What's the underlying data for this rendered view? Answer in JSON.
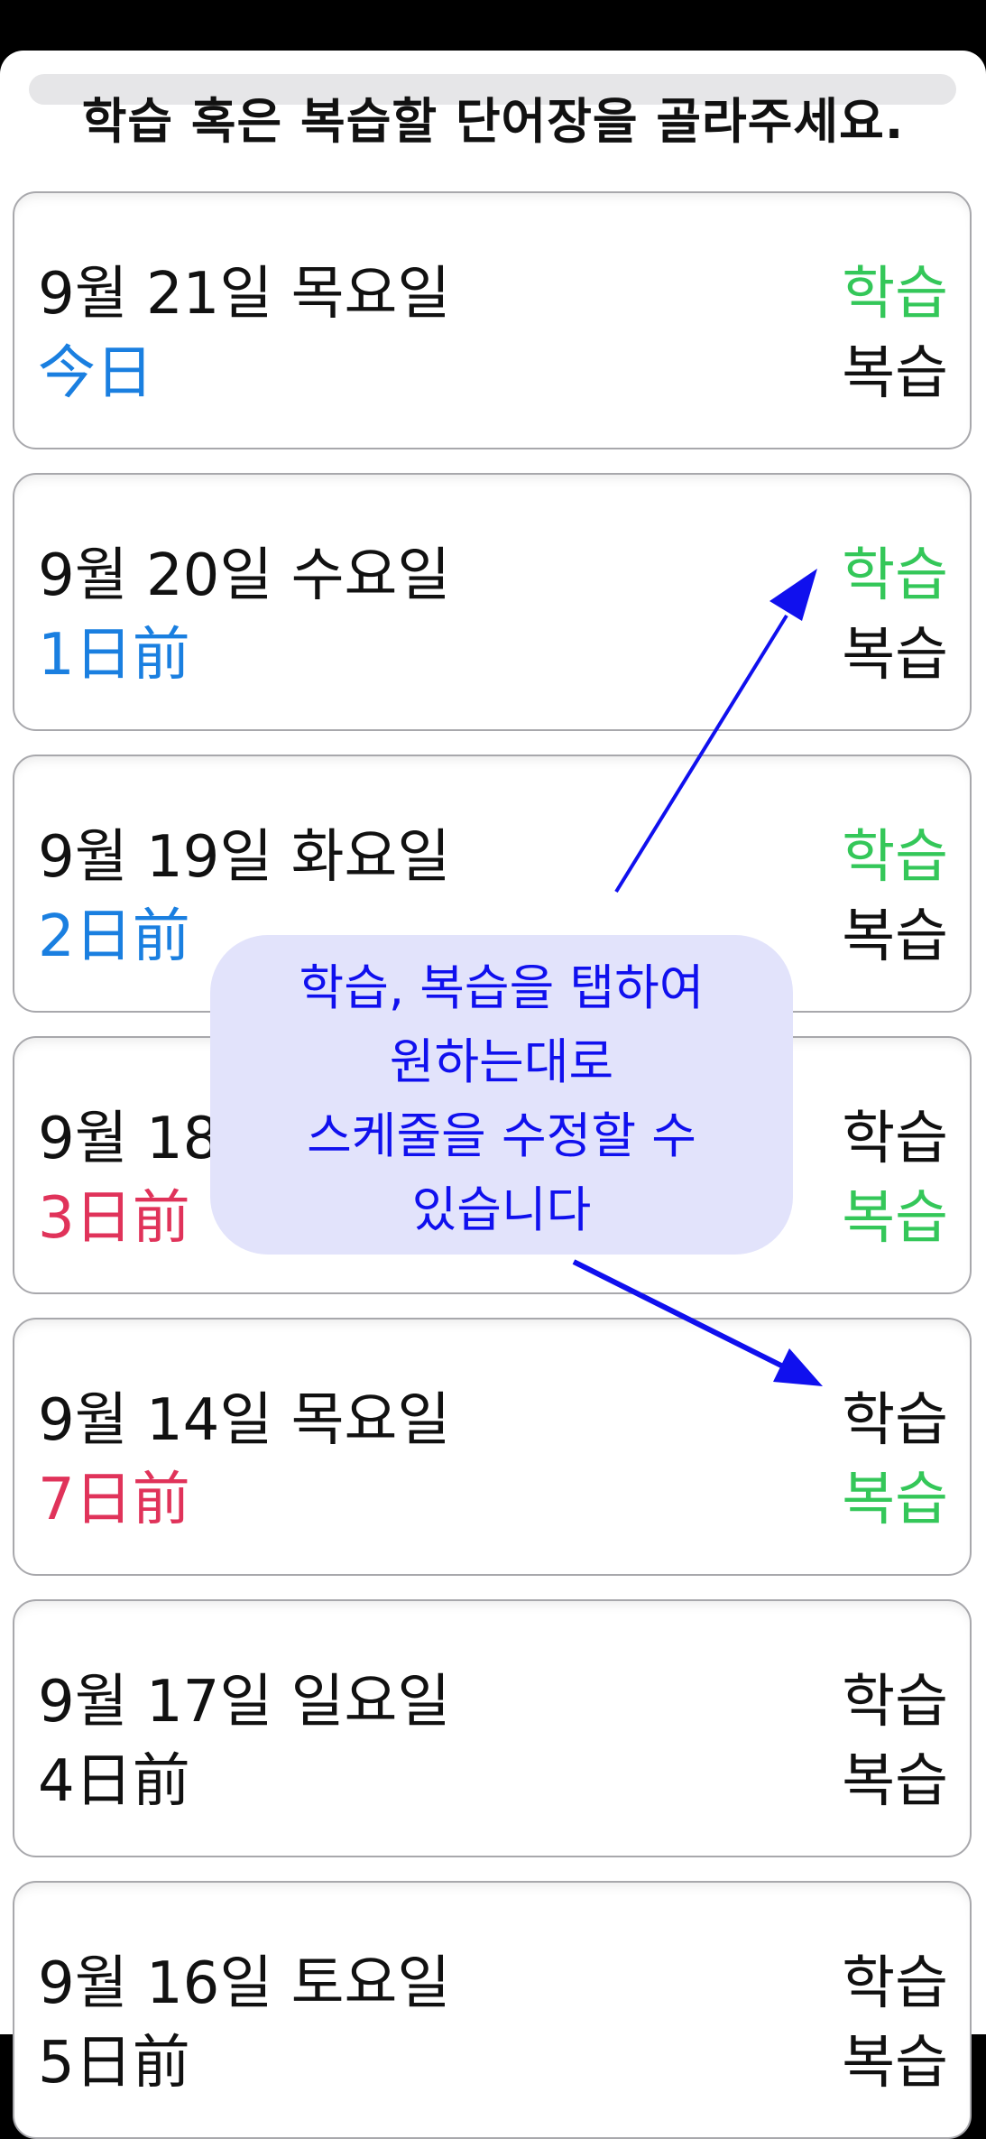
{
  "sheet": {
    "title": "학습 혹은 복습할 단어장을 골라주세요."
  },
  "cards": [
    {
      "date": "9월 21일 목요일",
      "ago": "今日",
      "ago_color": "blue",
      "learn": "학습",
      "learn_color": "green",
      "review": "복습",
      "review_color": "black"
    },
    {
      "date": "9월 20일 수요일",
      "ago": "1日前",
      "ago_color": "blue",
      "learn": "학습",
      "learn_color": "green",
      "review": "복습",
      "review_color": "black"
    },
    {
      "date": "9월 19일 화요일",
      "ago": "2日前",
      "ago_color": "blue",
      "learn": "학습",
      "learn_color": "green",
      "review": "복습",
      "review_color": "black"
    },
    {
      "date": "9월 18",
      "ago": "3日前",
      "ago_color": "red",
      "learn": "학습",
      "learn_color": "black",
      "review": "복습",
      "review_color": "green"
    },
    {
      "date": "9월 14일 목요일",
      "ago": "7日前",
      "ago_color": "red",
      "learn": "학습",
      "learn_color": "black",
      "review": "복습",
      "review_color": "green"
    },
    {
      "date": "9월 17일 일요일",
      "ago": "4日前",
      "ago_color": "black",
      "learn": "학습",
      "learn_color": "black",
      "review": "복습",
      "review_color": "black"
    },
    {
      "date": "9월 16일 토요일",
      "ago": "5日前",
      "ago_color": "black",
      "learn": "학습",
      "learn_color": "black",
      "review": "복습",
      "review_color": "black"
    }
  ],
  "callout": {
    "lines": [
      "학습, 복습을 탭하여",
      "원하는대로",
      "스케줄을 수정할 수",
      "있습니다"
    ]
  },
  "colors": {
    "green": "#34c759",
    "blue": "#1a7fe0",
    "red": "#e0335a",
    "black": "#111111",
    "annotation": "#1010ee",
    "callout_bg": "#e2e3fb"
  }
}
